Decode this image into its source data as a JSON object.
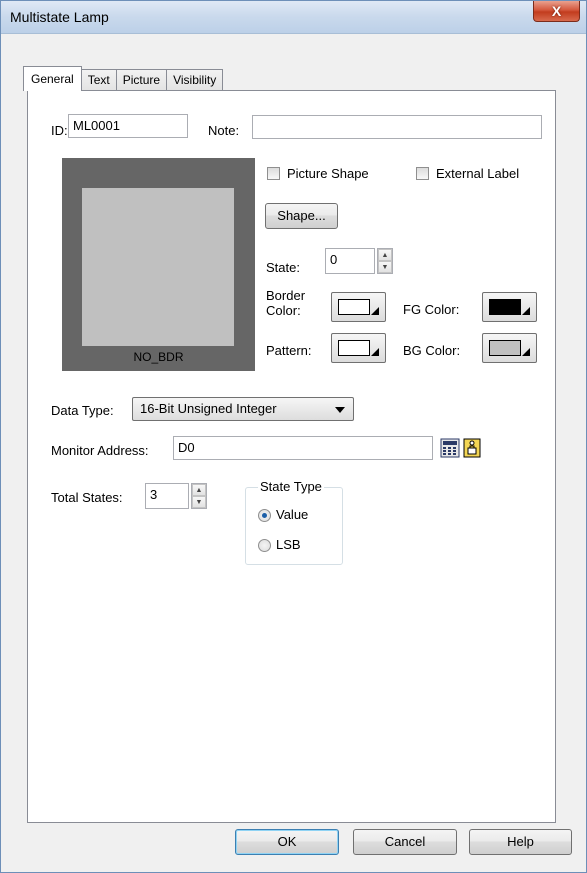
{
  "window": {
    "title": "Multistate Lamp",
    "close_glyph": "X"
  },
  "tabs": [
    {
      "label": "General",
      "active": true
    },
    {
      "label": "Text",
      "active": false
    },
    {
      "label": "Picture",
      "active": false
    },
    {
      "label": "Visibility",
      "active": false
    }
  ],
  "general": {
    "id_label": "ID:",
    "id_value": "ML0001",
    "note_label": "Note:",
    "note_value": "",
    "preview_caption": "NO_BDR",
    "picture_shape_label": "Picture Shape",
    "external_label_label": "External Label",
    "shape_button": "Shape...",
    "state_label": "State:",
    "state_value": "0",
    "border_color_label_1": "Border",
    "border_color_label_2": "Color:",
    "fg_color_label": "FG Color:",
    "pattern_label": "Pattern:",
    "bg_color_label": "BG Color:",
    "data_type_label": "Data Type:",
    "data_type_value": "16-Bit Unsigned Integer",
    "monitor_address_label": "Monitor Address:",
    "monitor_address_value": "D0",
    "total_states_label": "Total States:",
    "total_states_value": "3",
    "state_type_label": "State Type",
    "state_type_options": [
      "Value",
      "LSB"
    ],
    "state_type_selected": "Value"
  },
  "colors": {
    "border_color": "#ffffff",
    "fg_color": "#000000",
    "pattern": "#ffffff",
    "bg_color": "#c0c0c0"
  },
  "footer": {
    "ok": "OK",
    "cancel": "Cancel",
    "help": "Help"
  }
}
